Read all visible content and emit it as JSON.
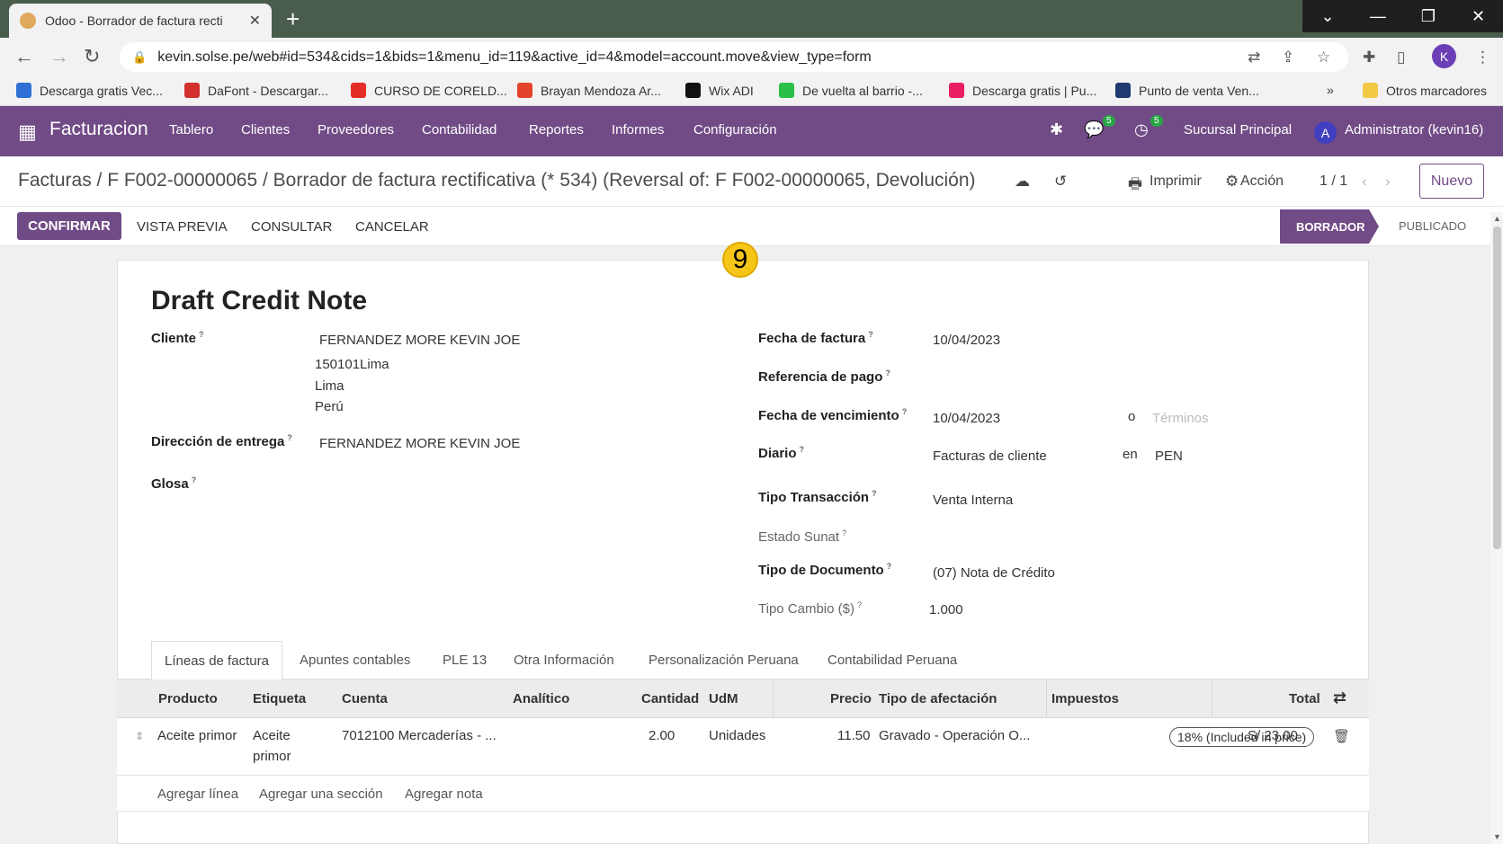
{
  "browser": {
    "tab_title": "Odoo - Borrador de factura recti",
    "tab_close": "✕",
    "new_tab": "+",
    "url": "kevin.solse.pe/web#id=534&cids=1&bids=1&menu_id=119&active_id=4&model=account.move&view_type=form",
    "profile_initial": "K",
    "bookmarks": [
      {
        "label": "Descarga gratis Vec...",
        "color": "#2f6fd6"
      },
      {
        "label": "DaFont - Descargar...",
        "color": "#d32f2f"
      },
      {
        "label": "CURSO DE CORELD...",
        "color": "#e52d27"
      },
      {
        "label": "Brayan Mendoza Ar...",
        "color": "#e2432a"
      },
      {
        "label": "Wix ADI",
        "color": "#111111"
      },
      {
        "label": "De vuelta al barrio -...",
        "color": "#2bbf4a"
      },
      {
        "label": "Descarga gratis | Pu...",
        "color": "#e91e63"
      },
      {
        "label": "Punto de venta Ven...",
        "color": "#1f3b70"
      }
    ],
    "bookmarks_more": "»",
    "other_bookmarks": "Otros marcadores"
  },
  "navbar": {
    "app_name": "Facturacion",
    "menu": [
      "Tablero",
      "Clientes",
      "Proveedores",
      "Contabilidad",
      "Reportes",
      "Informes",
      "Configuración"
    ],
    "chat_badge": "5",
    "activity_badge": "5",
    "branch": "Sucursal Principal",
    "user_initial": "A",
    "user": "Administrator (kevin16)"
  },
  "control_panel": {
    "breadcrumb": "Facturas / F F002-00000065 / Borrador de factura rectificativa (* 534) (Reversal of: F F002-00000065, Devolución)",
    "print": "Imprimir",
    "action": "Acción",
    "pager": "1 / 1",
    "new_button": "Nuevo"
  },
  "actions": {
    "confirm": "CONFIRMAR",
    "preview": "VISTA PREVIA",
    "consult": "CONSULTAR",
    "cancel": "CANCELAR",
    "status_current": "BORRADOR",
    "status_next": "PUBLICADO"
  },
  "overlay_number": "9",
  "form": {
    "title": "Draft Credit Note",
    "cliente_label": "Cliente",
    "cliente_name": "FERNANDEZ MORE KEVIN JOE",
    "cliente_addr1": "150101Lima",
    "cliente_addr2": "Lima",
    "cliente_addr3": "Perú",
    "entrega_label": "Dirección de entrega",
    "entrega_value": "FERNANDEZ MORE KEVIN JOE",
    "glosa_label": "Glosa",
    "fecha_factura_label": "Fecha de factura",
    "fecha_factura": "10/04/2023",
    "ref_pago_label": "Referencia de pago",
    "vencimiento_label": "Fecha de vencimiento",
    "vencimiento": "10/04/2023",
    "o_text": "o",
    "terminos_placeholder": "Términos",
    "diario_label": "Diario",
    "diario": "Facturas de cliente",
    "en_text": "en",
    "currency": "PEN",
    "tipo_trans_label": "Tipo Transacción",
    "tipo_trans": "Venta Interna",
    "estado_sunat_label": "Estado Sunat",
    "tipo_doc_label": "Tipo de Documento",
    "tipo_doc": "(07) Nota de Crédito",
    "tipo_cambio_label": "Tipo Cambio ($)",
    "tipo_cambio": "1.000",
    "help_mark": "?"
  },
  "tabs": [
    "Líneas de factura",
    "Apuntes contables",
    "PLE 13",
    "Otra Información",
    "Personalización Peruana",
    "Contabilidad Peruana"
  ],
  "table": {
    "headers": {
      "producto": "Producto",
      "etiqueta": "Etiqueta",
      "cuenta": "Cuenta",
      "analitico": "Analítico",
      "cantidad": "Cantidad",
      "udm": "UdM",
      "precio": "Precio",
      "afectacion": "Tipo de afectación",
      "impuestos": "Impuestos",
      "total": "Total"
    },
    "row": {
      "producto": "Aceite primor",
      "etiqueta_1": "Aceite",
      "etiqueta_2": "primor",
      "cuenta": "7012100 Mercaderías - ...",
      "cantidad": "2.00",
      "udm": "Unidades",
      "precio": "11.50",
      "afectacion": "Gravado - Operación O...",
      "impuesto": "18% (Included in price)",
      "total": "S/ 23.00"
    },
    "add_line": "Agregar línea",
    "add_section": "Agregar una sección",
    "add_note": "Agregar nota"
  },
  "colors": {
    "brand": "#714b86",
    "chrome_tabstrip": "#4a5d4d"
  }
}
